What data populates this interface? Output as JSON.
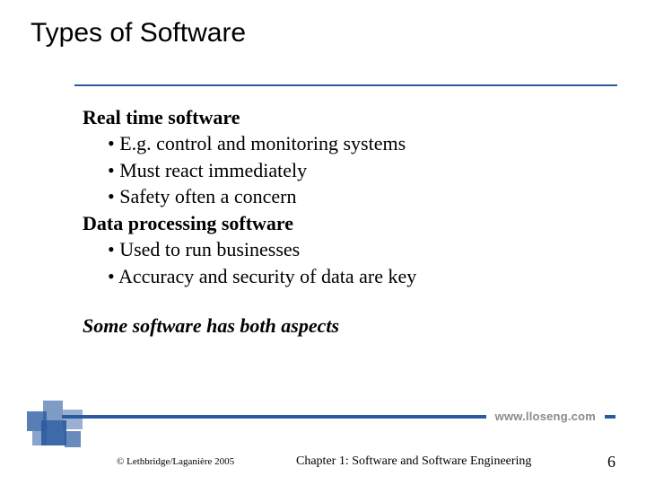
{
  "title": "Types of Software",
  "section1": {
    "heading": "Real time software",
    "bullets": [
      "E.g. control and monitoring systems",
      "Must react immediately",
      "Safety often a concern"
    ]
  },
  "section2": {
    "heading": "Data processing software",
    "bullets": [
      "Used to run businesses",
      "Accuracy and security of data are key"
    ]
  },
  "closing": "Some software has both aspects",
  "url": "www.lloseng.com",
  "copyright": "© Lethbridge/Laganière 2005",
  "chapter": "Chapter 1: Software and Software Engineering",
  "page": "6"
}
